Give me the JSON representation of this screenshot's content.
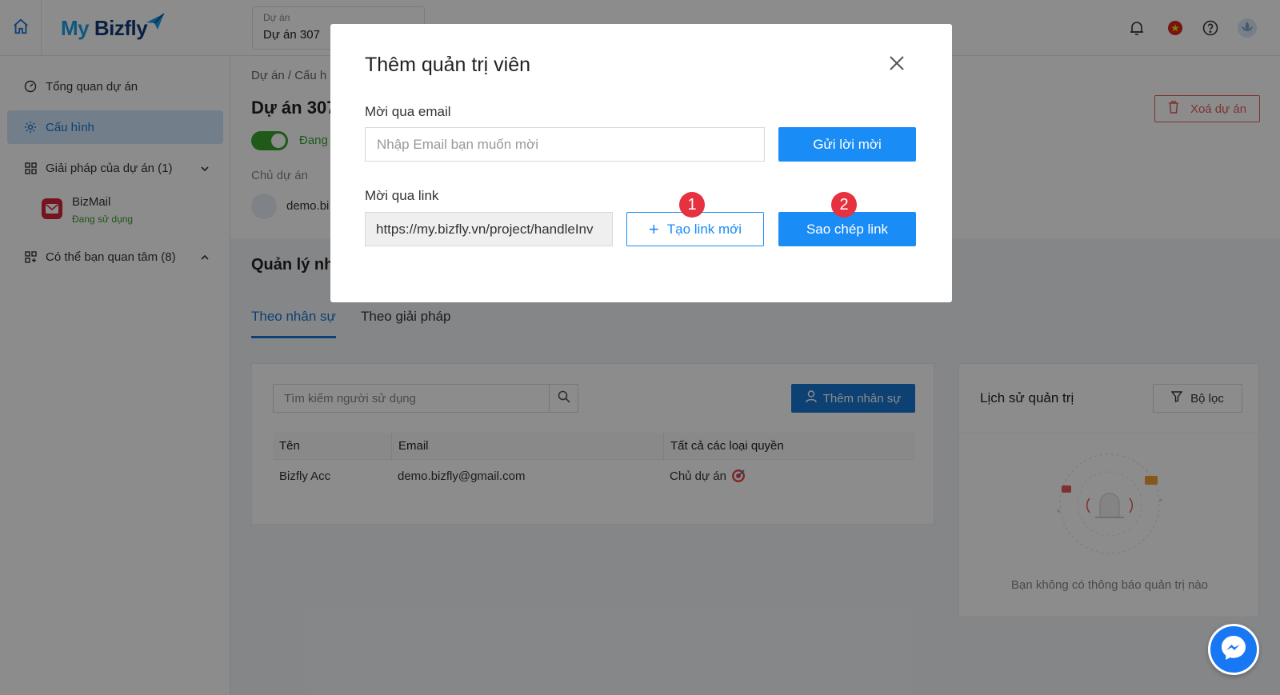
{
  "header": {
    "logo_my": "My",
    "logo_bizfly": "Bizfly",
    "project_label": "Dự án",
    "project_value": "Dự án 307"
  },
  "sidebar": {
    "items": [
      {
        "label": "Tổng quan dự án"
      },
      {
        "label": "Cấu hình"
      },
      {
        "label": "Giải pháp của dự án (1)"
      },
      {
        "label": "Có thể bạn quan tâm (8)"
      }
    ],
    "bizmail": {
      "name": "BizMail",
      "status": "Đang sử dụng"
    }
  },
  "main": {
    "breadcrumb": "Dự án  /  Cấu h",
    "title": "Dự án 307",
    "status": "Đang",
    "owner_label": "Chủ dự án",
    "owner_name": "demo.bi",
    "delete_label": "Xoá dự án",
    "section_title": "Quản lý nh",
    "tabs": [
      {
        "label": "Theo nhân sự"
      },
      {
        "label": "Theo giải pháp"
      }
    ],
    "users": {
      "search_placeholder": "Tìm kiếm người sử dụng",
      "add_label": "Thêm nhân sự",
      "columns": [
        "Tên",
        "Email",
        "Tất cả các loại quyền"
      ],
      "rows": [
        {
          "name": "Bizfly Acc",
          "email": "demo.bizfly@gmail.com",
          "role": "Chủ dự án"
        }
      ]
    },
    "history": {
      "title": "Lịch sử quản trị",
      "filter_label": "Bộ lọc",
      "empty_text": "Bạn không có thông báo quản trị nào"
    }
  },
  "modal": {
    "title": "Thêm quản trị viên",
    "email_label": "Mời qua email",
    "email_placeholder": "Nhập Email bạn muốn mời",
    "send_label": "Gửi lời mời",
    "link_label": "Mời qua link",
    "link_value": "https://my.bizfly.vn/project/handleInv",
    "new_link_label": "Tạo link mới",
    "copy_label": "Sao chép link",
    "badge1": "1",
    "badge2": "2"
  },
  "colors": {
    "primary": "#1a8cf5",
    "active_bg": "#cfe6fb",
    "danger": "#e0605a",
    "success": "#3aa52f",
    "badge": "#e5323e"
  },
  "icons": [
    "home-icon",
    "bell-icon",
    "flag-icon",
    "help-icon",
    "avatar",
    "dashboard-icon",
    "gear-icon",
    "grid-icon",
    "chevron-down-icon",
    "chevron-up-icon",
    "mail-icon",
    "trash-icon",
    "search-icon",
    "user-icon",
    "filter-icon",
    "close-icon",
    "plus-icon",
    "messenger-icon"
  ]
}
